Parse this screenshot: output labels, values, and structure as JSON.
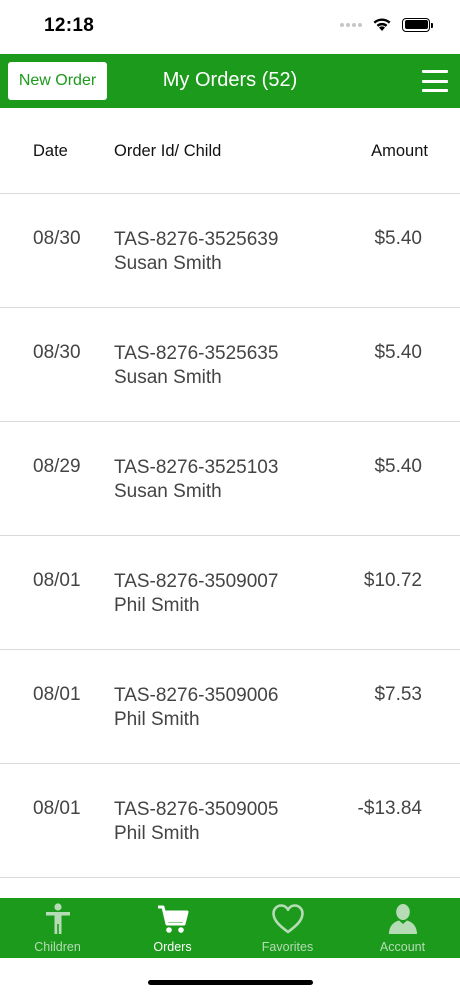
{
  "status_bar": {
    "time": "12:18"
  },
  "header": {
    "new_order_label": "New Order",
    "title": "My Orders (52)"
  },
  "table": {
    "columns": {
      "date": "Date",
      "order": "Order Id/ Child",
      "amount": "Amount"
    },
    "rows": [
      {
        "date": "08/30",
        "order_id": "TAS-8276-3525639",
        "child": "Susan Smith",
        "amount": "$5.40"
      },
      {
        "date": "08/30",
        "order_id": "TAS-8276-3525635",
        "child": "Susan Smith",
        "amount": "$5.40"
      },
      {
        "date": "08/29",
        "order_id": "TAS-8276-3525103",
        "child": "Susan Smith",
        "amount": "$5.40"
      },
      {
        "date": "08/01",
        "order_id": "TAS-8276-3509007",
        "child": "Phil Smith",
        "amount": "$10.72"
      },
      {
        "date": "08/01",
        "order_id": "TAS-8276-3509006",
        "child": "Phil Smith",
        "amount": "$7.53"
      },
      {
        "date": "08/01",
        "order_id": "TAS-8276-3509005",
        "child": "Phil Smith",
        "amount": "-$13.84"
      }
    ]
  },
  "tab_bar": {
    "tabs": [
      {
        "label": "Children",
        "icon": "person-icon"
      },
      {
        "label": "Orders",
        "icon": "cart-icon"
      },
      {
        "label": "Favorites",
        "icon": "heart-icon"
      },
      {
        "label": "Account",
        "icon": "account-icon"
      }
    ],
    "active": "Orders"
  },
  "colors": {
    "brand_green": "#1c9a1c",
    "tab_inactive": "#b6dcb6"
  }
}
